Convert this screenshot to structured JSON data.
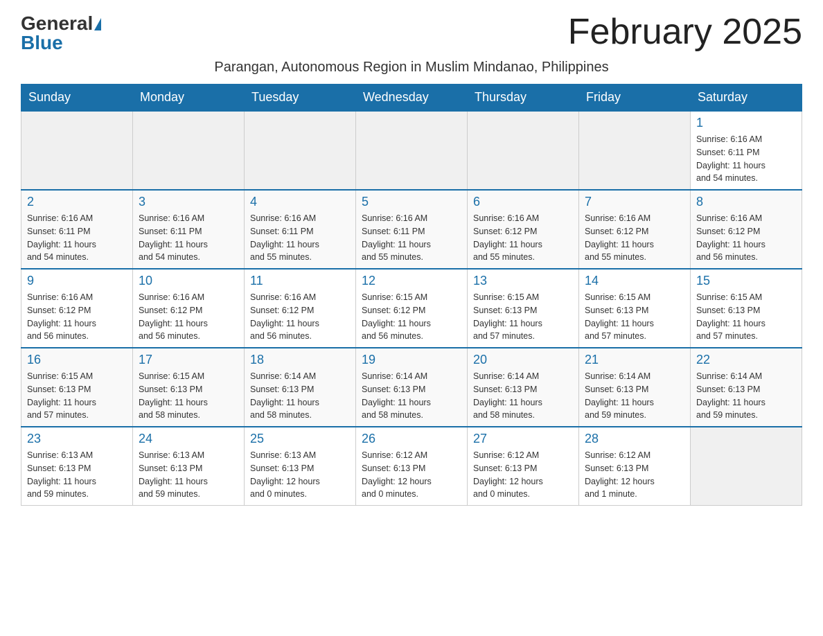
{
  "header": {
    "logo_general": "General",
    "logo_blue": "Blue",
    "month_title": "February 2025",
    "subtitle": "Parangan, Autonomous Region in Muslim Mindanao, Philippines"
  },
  "days_of_week": [
    "Sunday",
    "Monday",
    "Tuesday",
    "Wednesday",
    "Thursday",
    "Friday",
    "Saturday"
  ],
  "weeks": [
    [
      {
        "day": "",
        "info": ""
      },
      {
        "day": "",
        "info": ""
      },
      {
        "day": "",
        "info": ""
      },
      {
        "day": "",
        "info": ""
      },
      {
        "day": "",
        "info": ""
      },
      {
        "day": "",
        "info": ""
      },
      {
        "day": "1",
        "info": "Sunrise: 6:16 AM\nSunset: 6:11 PM\nDaylight: 11 hours\nand 54 minutes."
      }
    ],
    [
      {
        "day": "2",
        "info": "Sunrise: 6:16 AM\nSunset: 6:11 PM\nDaylight: 11 hours\nand 54 minutes."
      },
      {
        "day": "3",
        "info": "Sunrise: 6:16 AM\nSunset: 6:11 PM\nDaylight: 11 hours\nand 54 minutes."
      },
      {
        "day": "4",
        "info": "Sunrise: 6:16 AM\nSunset: 6:11 PM\nDaylight: 11 hours\nand 55 minutes."
      },
      {
        "day": "5",
        "info": "Sunrise: 6:16 AM\nSunset: 6:11 PM\nDaylight: 11 hours\nand 55 minutes."
      },
      {
        "day": "6",
        "info": "Sunrise: 6:16 AM\nSunset: 6:12 PM\nDaylight: 11 hours\nand 55 minutes."
      },
      {
        "day": "7",
        "info": "Sunrise: 6:16 AM\nSunset: 6:12 PM\nDaylight: 11 hours\nand 55 minutes."
      },
      {
        "day": "8",
        "info": "Sunrise: 6:16 AM\nSunset: 6:12 PM\nDaylight: 11 hours\nand 56 minutes."
      }
    ],
    [
      {
        "day": "9",
        "info": "Sunrise: 6:16 AM\nSunset: 6:12 PM\nDaylight: 11 hours\nand 56 minutes."
      },
      {
        "day": "10",
        "info": "Sunrise: 6:16 AM\nSunset: 6:12 PM\nDaylight: 11 hours\nand 56 minutes."
      },
      {
        "day": "11",
        "info": "Sunrise: 6:16 AM\nSunset: 6:12 PM\nDaylight: 11 hours\nand 56 minutes."
      },
      {
        "day": "12",
        "info": "Sunrise: 6:15 AM\nSunset: 6:12 PM\nDaylight: 11 hours\nand 56 minutes."
      },
      {
        "day": "13",
        "info": "Sunrise: 6:15 AM\nSunset: 6:13 PM\nDaylight: 11 hours\nand 57 minutes."
      },
      {
        "day": "14",
        "info": "Sunrise: 6:15 AM\nSunset: 6:13 PM\nDaylight: 11 hours\nand 57 minutes."
      },
      {
        "day": "15",
        "info": "Sunrise: 6:15 AM\nSunset: 6:13 PM\nDaylight: 11 hours\nand 57 minutes."
      }
    ],
    [
      {
        "day": "16",
        "info": "Sunrise: 6:15 AM\nSunset: 6:13 PM\nDaylight: 11 hours\nand 57 minutes."
      },
      {
        "day": "17",
        "info": "Sunrise: 6:15 AM\nSunset: 6:13 PM\nDaylight: 11 hours\nand 58 minutes."
      },
      {
        "day": "18",
        "info": "Sunrise: 6:14 AM\nSunset: 6:13 PM\nDaylight: 11 hours\nand 58 minutes."
      },
      {
        "day": "19",
        "info": "Sunrise: 6:14 AM\nSunset: 6:13 PM\nDaylight: 11 hours\nand 58 minutes."
      },
      {
        "day": "20",
        "info": "Sunrise: 6:14 AM\nSunset: 6:13 PM\nDaylight: 11 hours\nand 58 minutes."
      },
      {
        "day": "21",
        "info": "Sunrise: 6:14 AM\nSunset: 6:13 PM\nDaylight: 11 hours\nand 59 minutes."
      },
      {
        "day": "22",
        "info": "Sunrise: 6:14 AM\nSunset: 6:13 PM\nDaylight: 11 hours\nand 59 minutes."
      }
    ],
    [
      {
        "day": "23",
        "info": "Sunrise: 6:13 AM\nSunset: 6:13 PM\nDaylight: 11 hours\nand 59 minutes."
      },
      {
        "day": "24",
        "info": "Sunrise: 6:13 AM\nSunset: 6:13 PM\nDaylight: 11 hours\nand 59 minutes."
      },
      {
        "day": "25",
        "info": "Sunrise: 6:13 AM\nSunset: 6:13 PM\nDaylight: 12 hours\nand 0 minutes."
      },
      {
        "day": "26",
        "info": "Sunrise: 6:12 AM\nSunset: 6:13 PM\nDaylight: 12 hours\nand 0 minutes."
      },
      {
        "day": "27",
        "info": "Sunrise: 6:12 AM\nSunset: 6:13 PM\nDaylight: 12 hours\nand 0 minutes."
      },
      {
        "day": "28",
        "info": "Sunrise: 6:12 AM\nSunset: 6:13 PM\nDaylight: 12 hours\nand 1 minute."
      },
      {
        "day": "",
        "info": ""
      }
    ]
  ]
}
